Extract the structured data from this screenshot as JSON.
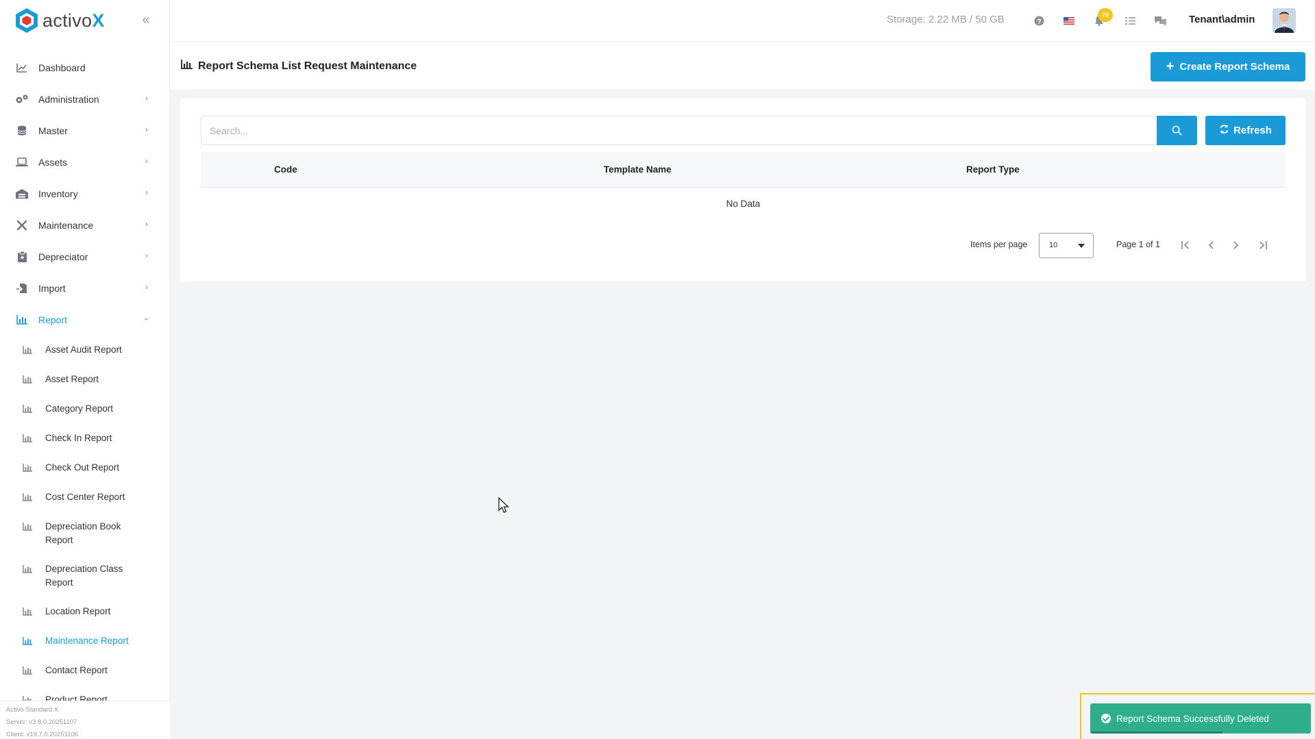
{
  "brand": {
    "name": "activo",
    "mark": "X"
  },
  "sidebar": {
    "items": [
      {
        "label": "Dashboard",
        "icon": "chart-line-icon",
        "expandable": false
      },
      {
        "label": "Administration",
        "icon": "gears-icon",
        "expandable": true
      },
      {
        "label": "Master",
        "icon": "database-icon",
        "expandable": true
      },
      {
        "label": "Assets",
        "icon": "laptop-icon",
        "expandable": true
      },
      {
        "label": "Inventory",
        "icon": "warehouse-icon",
        "expandable": true
      },
      {
        "label": "Maintenance",
        "icon": "tools-icon",
        "expandable": true
      },
      {
        "label": "Depreciator",
        "icon": "clipboard-icon",
        "expandable": true
      },
      {
        "label": "Import",
        "icon": "file-import-icon",
        "expandable": true
      },
      {
        "label": "Report",
        "icon": "bar-chart-icon",
        "expandable": true,
        "active": true
      }
    ],
    "report_sub_items": [
      {
        "label": "Asset Audit Report"
      },
      {
        "label": "Asset Report"
      },
      {
        "label": "Category Report"
      },
      {
        "label": "Check In Report"
      },
      {
        "label": "Check Out Report"
      },
      {
        "label": "Cost Center Report"
      },
      {
        "label": "Depreciation Book Report"
      },
      {
        "label": "Depreciation Class Report"
      },
      {
        "label": "Location Report"
      },
      {
        "label": "Maintenance Report",
        "active": true
      },
      {
        "label": "Contact Report"
      },
      {
        "label": "Product Report"
      }
    ],
    "footer": {
      "product": "Activo Standard X",
      "server": "Server: v3.8.0.20251107",
      "client": "Client: v19.7.0.20251106"
    }
  },
  "header": {
    "storage": "Storage: 2.22 MB / 50 GB",
    "notification_count": "70",
    "user": "Tenant\\admin"
  },
  "page": {
    "title": "Report Schema List Request Maintenance",
    "create_button": "Create Report Schema"
  },
  "table": {
    "search_placeholder": "Search...",
    "refresh_label": "Refresh",
    "columns": [
      "Code",
      "Template Name",
      "Report Type"
    ],
    "empty_text": "No Data",
    "items_per_page_label": "Items per page",
    "items_per_page": "10",
    "page_info": "Page 1 of 1"
  },
  "toast": {
    "message": "Report Schema Successfully Deleted",
    "progress": 0.6
  },
  "colors": {
    "accent": "#1a9bd7",
    "success": "#2fae8b",
    "highlight": "#f0c419",
    "badge": "#f5c518"
  }
}
